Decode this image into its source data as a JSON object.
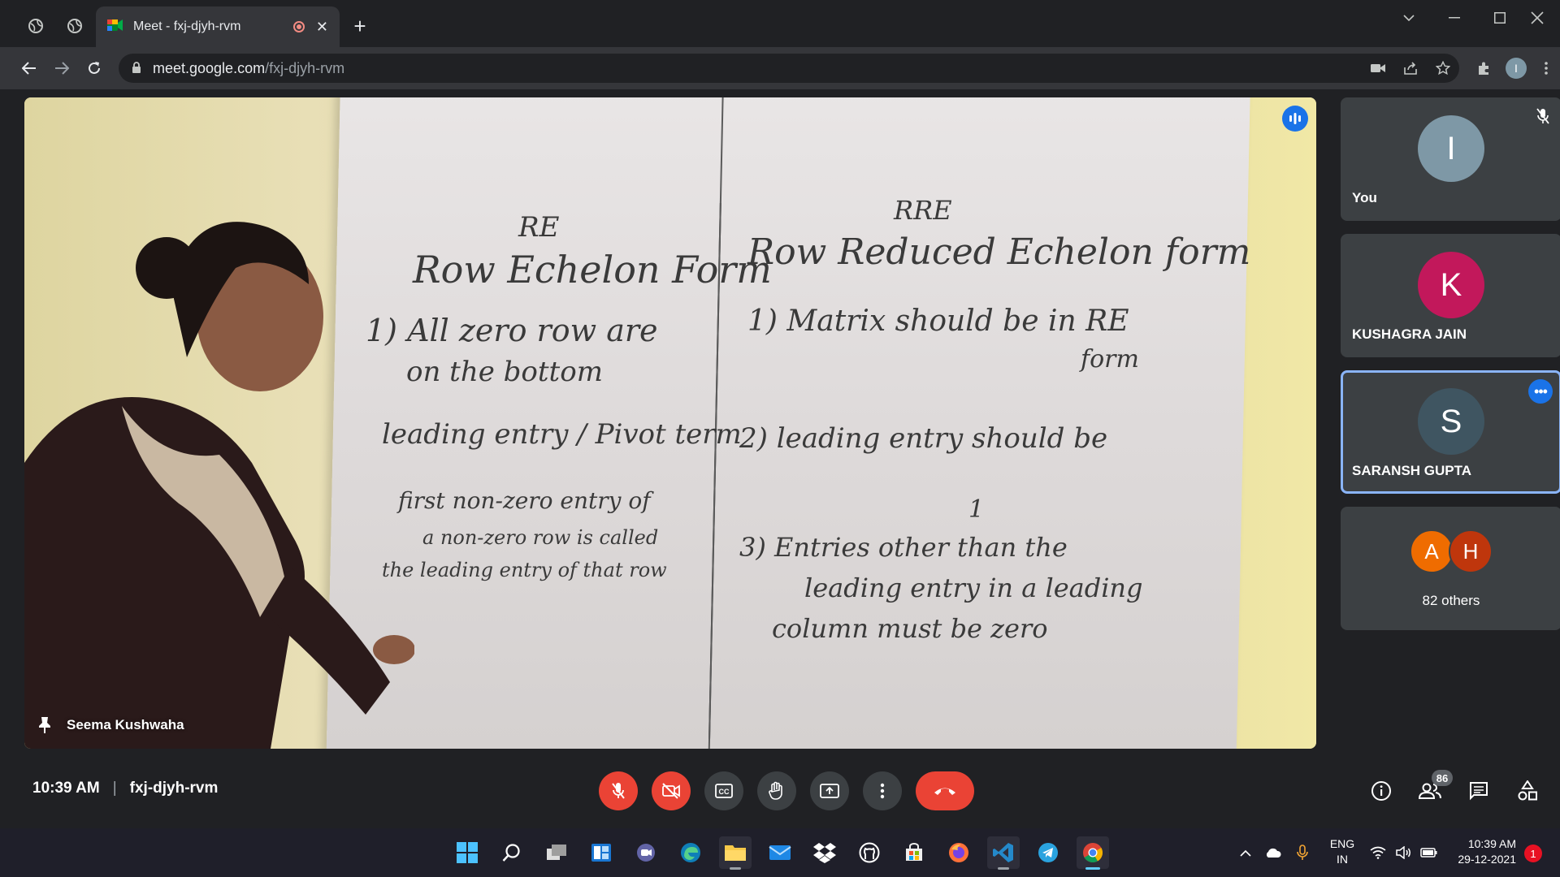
{
  "browser": {
    "tab_title": "Meet - fxj-djyh-rvm",
    "url_host": "meet.google.com",
    "url_path": "/fxj-djyh-rvm"
  },
  "stage": {
    "speaker_name": "Seema Kushwaha",
    "board": {
      "left_heading_abbrev": "RE",
      "left_heading": "Row Echelon Form",
      "left_point1_line1": "1) All zero row are",
      "left_point1_line2": "on the bottom",
      "left_point2": "leading entry / Pivot term",
      "left_point3_line1": "first non-zero entry of",
      "left_point3_line2": "a non-zero row is called",
      "left_point3_line3": "the leading entry of that row",
      "right_heading_abbrev": "RRE",
      "right_heading": "Row Reduced Echelon form",
      "right_point1_line1": "1) Matrix should be in RE",
      "right_point1_line2": "form",
      "right_point2": "2) leading entry should be",
      "right_point2_value": "1",
      "right_point3_line1": "3) Entries other than the",
      "right_point3_line2": "leading entry in a leading",
      "right_point3_line3": "column must be zero"
    }
  },
  "participants": [
    {
      "initial": "I",
      "name": "You",
      "color": "#7e98a6",
      "muted": true
    },
    {
      "initial": "K",
      "name": "KUSHAGRA JAIN",
      "color": "#c2185b"
    },
    {
      "initial": "S",
      "name": "SARANSH GUPTA",
      "color": "#3f5561",
      "active": true
    }
  ],
  "others": {
    "avatars": [
      {
        "initial": "A",
        "color": "#ef6c00"
      },
      {
        "initial": "H",
        "color": "#bf360c"
      }
    ],
    "label": "82 others"
  },
  "meeting": {
    "time": "10:39 AM",
    "code": "fxj-djyh-rvm",
    "participant_count": "86"
  },
  "taskbar": {
    "lang_line1": "ENG",
    "lang_line2": "IN",
    "time": "10:39 AM",
    "date": "29-12-2021",
    "notifications": "1"
  }
}
